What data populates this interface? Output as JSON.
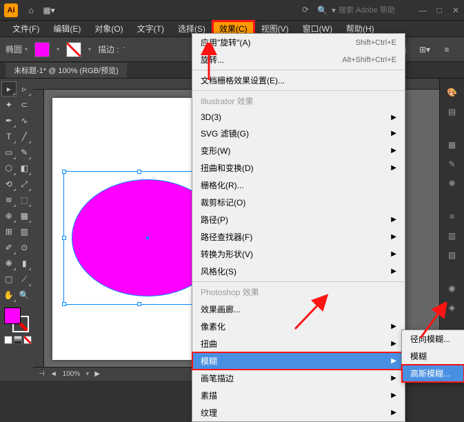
{
  "titlebar": {
    "logo_text": "Ai",
    "search_placeholder": "搜索 Adobe 帮助"
  },
  "menubar": {
    "file": "文件(F)",
    "edit": "编辑(E)",
    "object": "对象(O)",
    "type": "文字(T)",
    "select": "选择(S)",
    "effect": "效果(C)",
    "view": "视图(V)",
    "window": "窗口(W)",
    "help": "帮助(H)"
  },
  "controlbar": {
    "shape_label": "椭圆",
    "stroke_label": "描边 :"
  },
  "doctab": {
    "title": "未标题-1* @ 100% (RGB/预览)"
  },
  "dropdown": {
    "apply_rotate": "应用\"旋转\"(A)",
    "apply_rotate_sc": "Shift+Ctrl+E",
    "rotate": "旋转...",
    "rotate_sc": "Alt+Shift+Ctrl+E",
    "doc_raster": "文档栅格效果设置(E)...",
    "illustrator_fx": "Illustrator 效果",
    "threed": "3D(3)",
    "svg_filter": "SVG 滤镜(G)",
    "warp": "变形(W)",
    "distort": "扭曲和变换(D)",
    "rasterize": "栅格化(R)...",
    "cropmarks": "裁剪标记(O)",
    "path": "路径(P)",
    "pathfinder": "路径查找器(F)",
    "convert": "转换为形状(V)",
    "stylize": "风格化(S)",
    "photoshop_fx": "Photoshop 效果",
    "gallery": "效果画廊...",
    "pixelate": "像素化",
    "distort2": "扭曲",
    "blur": "模糊",
    "brush": "画笔描边",
    "sketch": "素描",
    "texture": "纹理"
  },
  "submenu": {
    "radial": "径向模糊...",
    "hidden": "模糊",
    "gaussian": "高斯模糊..."
  },
  "statusbar": {
    "zoom": "100%",
    "marker": "▶"
  }
}
